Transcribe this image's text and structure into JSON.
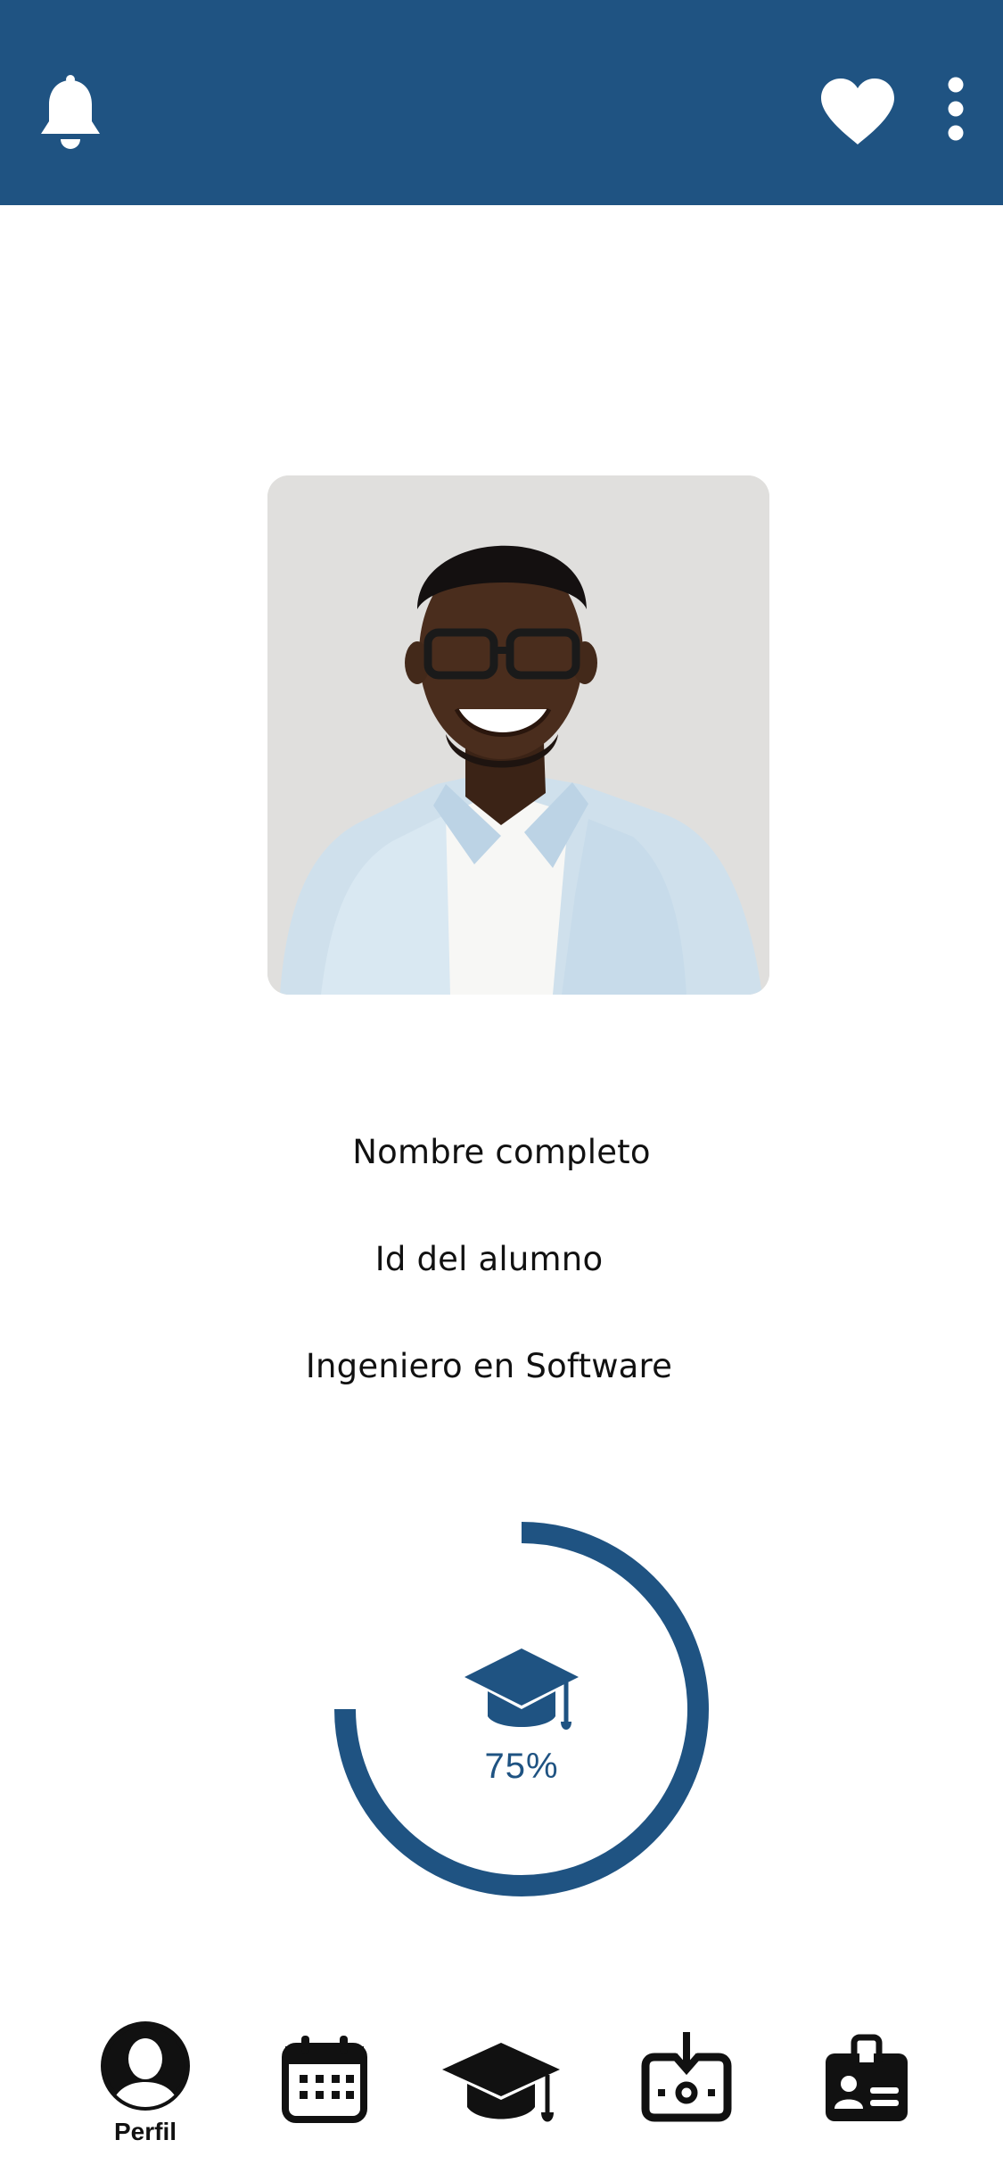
{
  "header": {
    "background_color": "#1f5382",
    "icons": [
      "bell-icon",
      "heart-icon",
      "more-vertical-icon"
    ]
  },
  "profile": {
    "photo": "student-portrait",
    "full_name": "Nombre completo",
    "student_id": "Id del alumno",
    "career": "Ingeniero en Software"
  },
  "progress": {
    "value_label": "75%",
    "fraction": 0.75,
    "icon": "graduation-cap-icon",
    "color": "#1f5382"
  },
  "bottom_nav": {
    "items": [
      {
        "icon": "profile-icon",
        "label": "Perfil",
        "active": true
      },
      {
        "icon": "calendar-icon",
        "label": ""
      },
      {
        "icon": "graduation-cap-icon",
        "label": ""
      },
      {
        "icon": "download-icon",
        "label": ""
      },
      {
        "icon": "id-card-icon",
        "label": ""
      }
    ]
  }
}
